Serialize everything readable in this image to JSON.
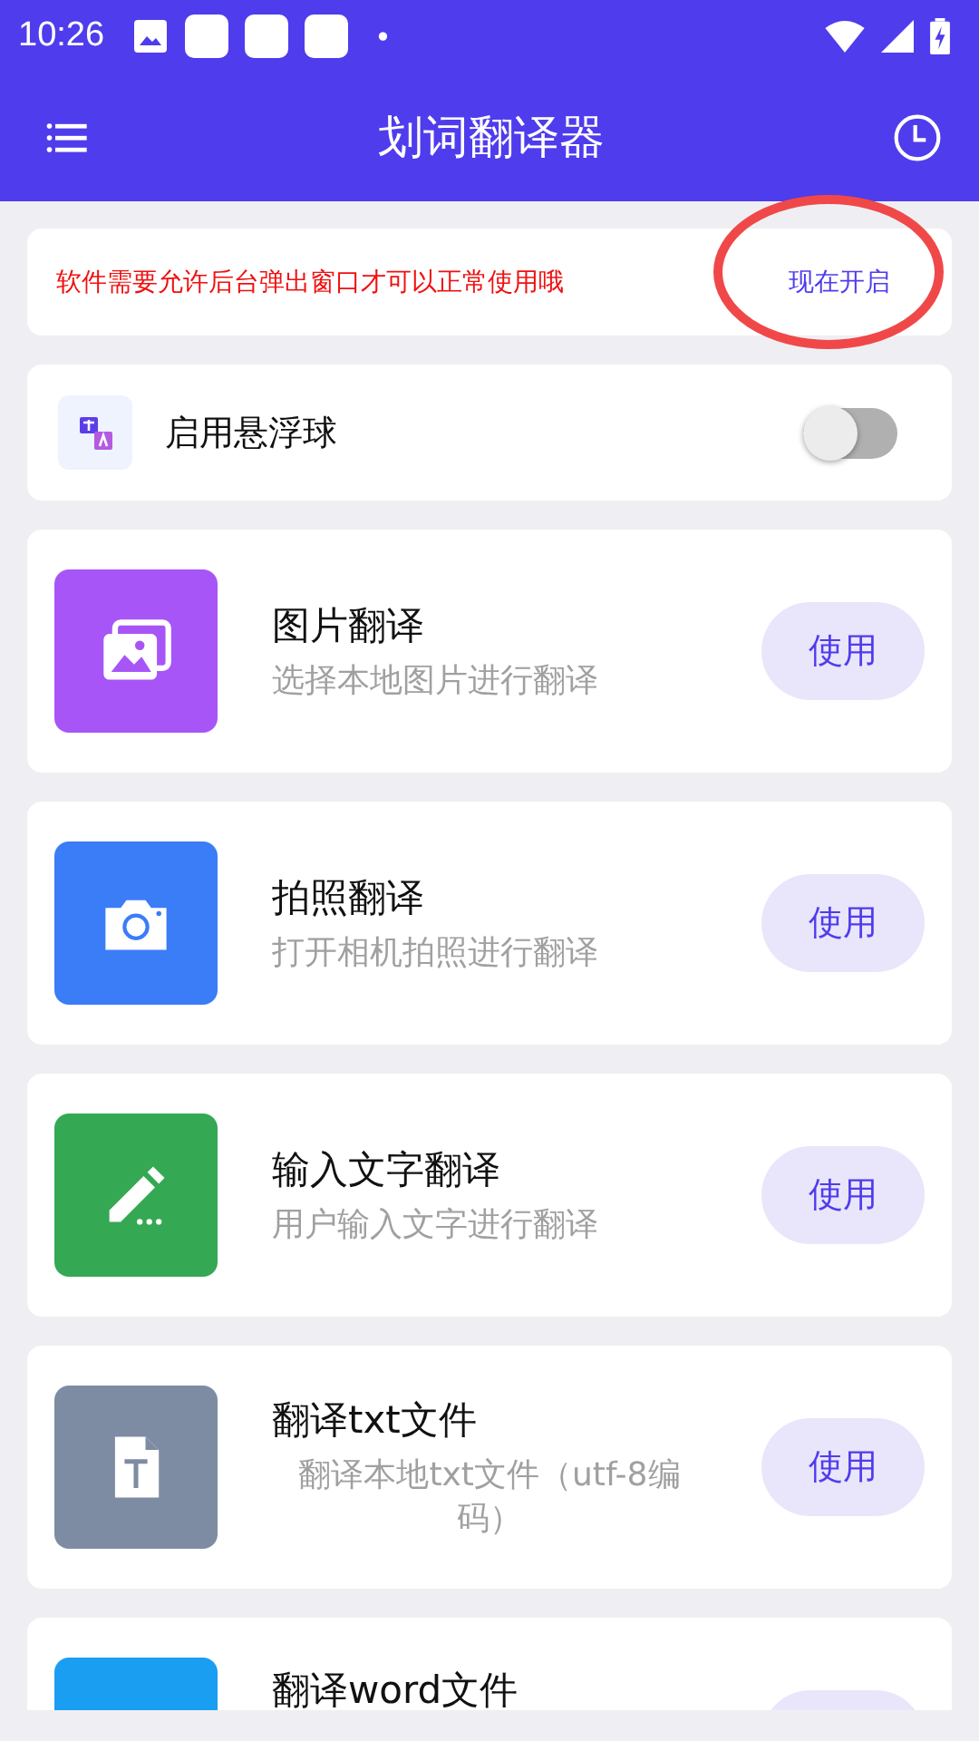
{
  "status_bar": {
    "time": "10:26",
    "dot": "•"
  },
  "app_bar": {
    "title": "划词翻译器"
  },
  "notice": {
    "message": "软件需要允许后台弹出窗口才可以正常使用哦",
    "action": "现在开启",
    "circled": true
  },
  "float_ball": {
    "label": "启用悬浮球",
    "on": false
  },
  "tools": [
    {
      "kind": "image",
      "color": "#a855f7",
      "title": "图片翻译",
      "subtitle": "选择本地图片进行翻译",
      "button": "使用"
    },
    {
      "kind": "camera",
      "color": "#3b7cf7",
      "title": "拍照翻译",
      "subtitle": "打开相机拍照进行翻译",
      "button": "使用"
    },
    {
      "kind": "pen",
      "color": "#34a853",
      "title": "输入文字翻译",
      "subtitle": "用户输入文字进行翻译",
      "button": "使用"
    },
    {
      "kind": "txt",
      "color": "#7d8ca3",
      "title": "翻译txt文件",
      "subtitle": "翻译本地txt文件（utf-8编码）",
      "button": "使用"
    },
    {
      "kind": "word",
      "color": "#1a9ef2",
      "title": "翻译word文件"
    }
  ]
}
